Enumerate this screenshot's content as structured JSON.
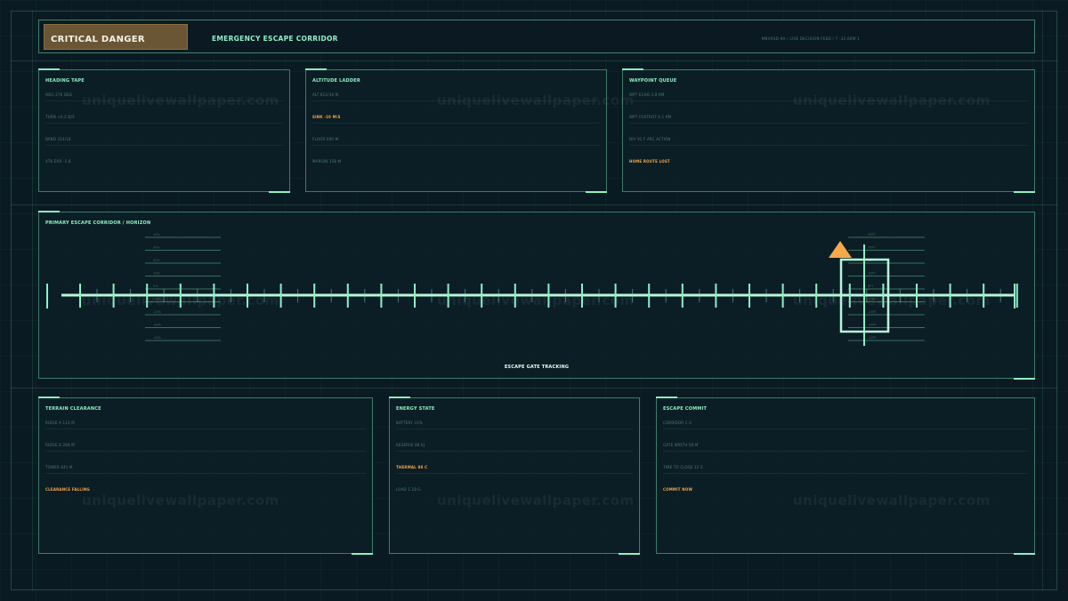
{
  "header": {
    "status": "CRITICAL DANGER",
    "title": "EMERGENCY ESCAPE CORRIDOR",
    "meta": "MNVRSD-9A  /  LIVE DECISION FEED  /  T -32.6KM 1"
  },
  "panels": {
    "heading": {
      "title": "HEADING TAPE",
      "rows": [
        "HDG 276 DEG",
        "TURN +6.2 D/S",
        "WIND 314/18",
        "XTK ERR -1.8"
      ]
    },
    "altitude": {
      "title": "ALTITUDE LADDER",
      "rows": [
        "ALT 812/36 M",
        "SINK -10 M/S",
        "FLOOR 690 M",
        "MARGIN 158 M"
      ]
    },
    "waypoint": {
      "title": "WAYPOINT QUEUE",
      "rows": [
        "WPT ECHO 3.8 KM",
        "WPT FOXTROT 6.1 KM",
        "DIV 91 F ARC ACTION",
        "HOME ROUTE LOST"
      ]
    },
    "terrain": {
      "title": "TERRAIN CLEARANCE",
      "rows": [
        "RIDGE A 112 M",
        "RIDGE B 268 M",
        "TOWER 641 M",
        "CLEARANCE FALLING"
      ]
    },
    "energy": {
      "title": "ENERGY STATE",
      "rows": [
        "BATTERY 31%",
        "RESERVE 88 KJ",
        "THERMAL 88 C",
        "LOAD 1.18 G"
      ]
    },
    "commit": {
      "title": "ESCAPE COMMIT",
      "rows": [
        "CORRIDOR C-3",
        "GATE WIDTH 58 M",
        "TIME TO CLOSE 12 S",
        "COMMIT NOW"
      ]
    }
  },
  "corridor": {
    "title": "PRIMARY ESCAPE CORRIDOR / HORIZON",
    "label": "ESCAPE GATE TRACKING",
    "ladder_left": [
      "10%",
      "30%",
      "20%",
      "10%",
      "0%",
      "-10%",
      "-20%",
      "-30%",
      "-40%"
    ],
    "ladder_right": [
      "40FT",
      "30FT",
      "20FT",
      "10FT",
      "0FT",
      "-10FT",
      "-20FT",
      "-30FT",
      "-40FT"
    ]
  },
  "watermark": "uniquelivewallpaper.com",
  "colors": {
    "accent": "#8ff0c4",
    "warning": "#f7a84a",
    "danger_badge": "#6a5535",
    "background": "#0a1a22"
  }
}
